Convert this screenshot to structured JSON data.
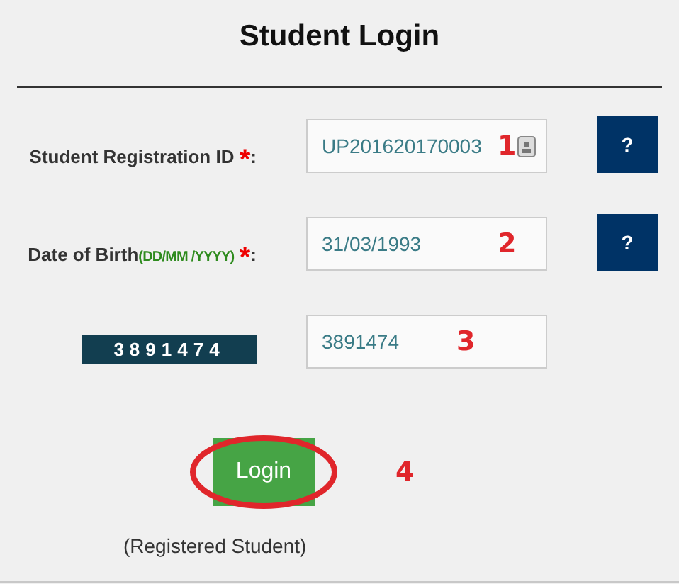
{
  "title": "Student Login",
  "fields": [
    {
      "label": "Student Registration ID",
      "required_mark": "*",
      "colon": ":",
      "value": "UP201620170003",
      "marker": "1",
      "help": "?",
      "has_card_icon": true
    },
    {
      "label": "Date of Birth",
      "hint": "(DD/MM /YYYY)",
      "required_mark": "*",
      "colon": ":",
      "value": "31/03/1993",
      "marker": "2",
      "help": "?",
      "has_card_icon": false
    }
  ],
  "captcha": {
    "code": "3891474",
    "value": "3891474",
    "marker": "3"
  },
  "login": {
    "label": "Login",
    "marker": "4",
    "circled": true
  },
  "note": "(Registered Student)"
}
